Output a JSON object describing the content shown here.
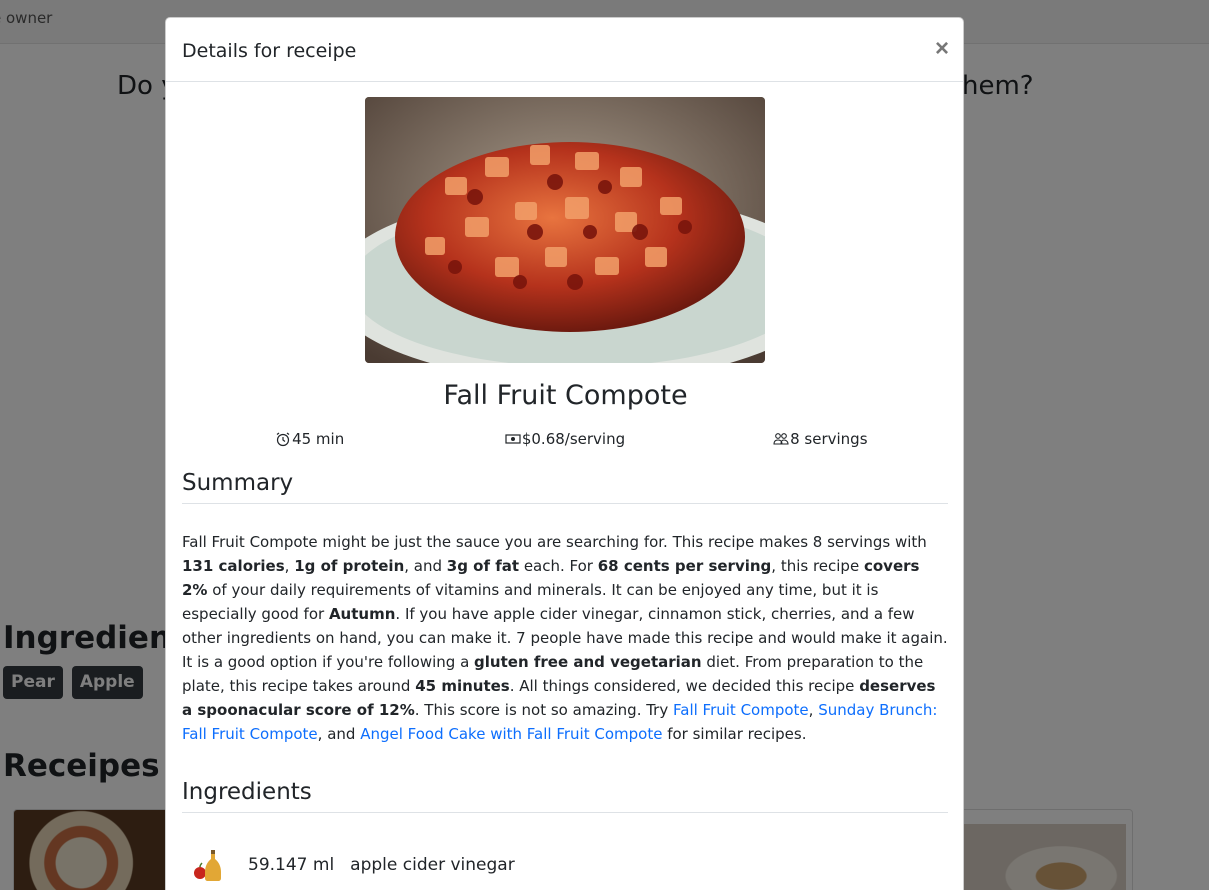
{
  "background": {
    "owner_text": "e owner",
    "question_left": "Do y",
    "question_right": "hem?",
    "ingredients_heading": "Ingredients",
    "ingredient_badges": [
      "Pear",
      "Apple"
    ],
    "receipes_heading": "Receipes"
  },
  "modal": {
    "title": "Details for receipe",
    "close_label": "×",
    "recipe_title": "Fall Fruit Compote",
    "meta": {
      "time": "45 min",
      "price": "$0.68/serving",
      "servings": "8 servings"
    },
    "summary_heading": "Summary",
    "summary": {
      "p1": "Fall Fruit Compote might be just the sauce you are searching for. This recipe makes 8 servings with ",
      "b1": "131 calories",
      "p2": ", ",
      "b2": "1g of protein",
      "p3": ", and ",
      "b3": "3g of fat",
      "p4": " each. For ",
      "b4": "68 cents per serving",
      "p5": ", this recipe ",
      "b5": "covers 2%",
      "p6": " of your daily requirements of vitamins and minerals. It can be enjoyed any time, but it is especially good for ",
      "b6": "Autumn",
      "p7": ". If you have apple cider vinegar, cinnamon stick, cherries, and a few other ingredients on hand, you can make it. 7 people have made this recipe and would make it again. It is a good option if you're following a ",
      "b7": "gluten free and vegetarian",
      "p8": " diet. From preparation to the plate, this recipe takes around ",
      "b8": "45 minutes",
      "p9": ". All things considered, we decided this recipe ",
      "b9": "deserves a spoonacular score of 12%",
      "p10": ". This score is not so amazing. Try ",
      "link1": "Fall Fruit Compote",
      "p11": ", ",
      "link2": "Sunday Brunch: Fall Fruit Compote",
      "p12": ", and ",
      "link3": "Angel Food Cake with Fall Fruit Compote",
      "p13": " for similar recipes."
    },
    "ingredients_heading": "Ingredients",
    "ingredients": [
      {
        "amount": "59.147 ml",
        "name": "apple cider vinegar",
        "icon": "apple-cider-vinegar-icon"
      }
    ]
  },
  "colors": {
    "link": "#0d6efd",
    "badge_bg": "#343a40",
    "overlay": "rgba(0,0,0,0.5)"
  }
}
